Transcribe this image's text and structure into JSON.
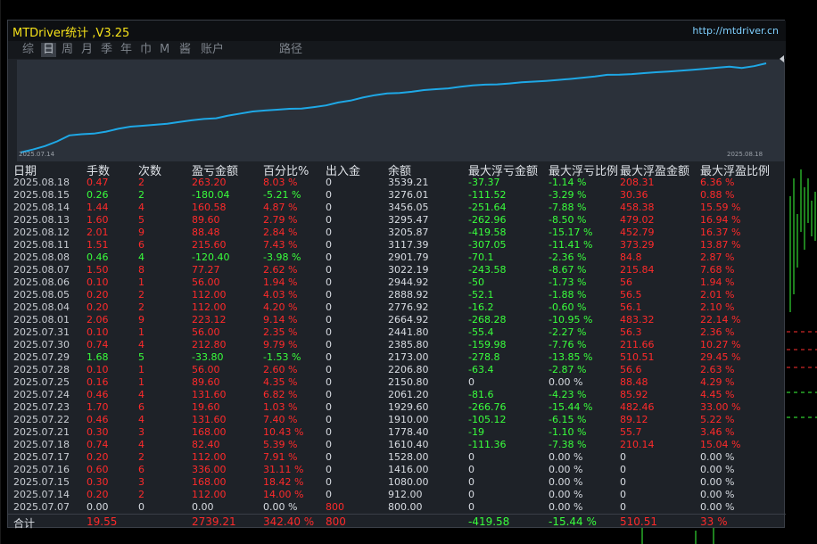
{
  "window": {
    "title": "MTDriver统计 ,V3.25",
    "url": "http://mtdriver.cn"
  },
  "tabs": [
    {
      "label": "综",
      "active": false
    },
    {
      "label": "日",
      "active": true
    },
    {
      "label": "周",
      "active": false
    },
    {
      "label": "月",
      "active": false
    },
    {
      "label": "季",
      "active": false
    },
    {
      "label": "年",
      "active": false
    },
    {
      "label": "巾",
      "active": false
    },
    {
      "label": "M",
      "active": false
    },
    {
      "label": "酱",
      "active": false
    },
    {
      "label": "账户",
      "active": false
    },
    {
      "label": "路径",
      "active": false
    }
  ],
  "equity_chart": {
    "start_date": "2025.07.14",
    "end_date": "2025.08.18",
    "line_color": "#1ea8e6",
    "values": [
      912,
      1000,
      1100,
      1240,
      1416,
      1450,
      1470,
      1528,
      1610,
      1675,
      1700,
      1730,
      1760,
      1810,
      1860,
      1900,
      1920,
      2000,
      2061,
      2120,
      2150,
      2173,
      2200,
      2206,
      2250,
      2300,
      2386,
      2441,
      2530,
      2600,
      2650,
      2665,
      2700,
      2750,
      2777,
      2800,
      2850,
      2889,
      2910,
      2920,
      2945,
      2980,
      3000,
      3022,
      3050,
      3080,
      3117,
      3150,
      3200,
      3206,
      3220,
      3250,
      3276,
      3295,
      3320,
      3350,
      3380,
      3410,
      3440,
      3400,
      3456,
      3539
    ]
  },
  "table": {
    "headers": [
      "日期",
      "手数",
      "次数",
      "盈亏金额",
      "百分比%",
      "出入金",
      "余额",
      "最大浮亏金额",
      "最大浮亏比例",
      "最大浮盈金额",
      "最大浮盈比例"
    ],
    "rows": [
      {
        "date": "2025.08.18",
        "lots": "0.47",
        "count": "2",
        "pnl": "263.20",
        "pct": "8.03 %",
        "io": "0",
        "balance": "3539.21",
        "maxdd": "-37.37",
        "maxdd_pct": "-1.14 %",
        "maxfp": "208.31",
        "maxfp_pct": "6.36 %",
        "sign": "pos"
      },
      {
        "date": "2025.08.15",
        "lots": "0.26",
        "count": "2",
        "pnl": "-180.04",
        "pct": "-5.21 %",
        "io": "0",
        "balance": "3276.01",
        "maxdd": "-111.52",
        "maxdd_pct": "-3.29 %",
        "maxfp": "30.36",
        "maxfp_pct": "0.88 %",
        "sign": "neg"
      },
      {
        "date": "2025.08.14",
        "lots": "1.44",
        "count": "4",
        "pnl": "160.58",
        "pct": "4.87 %",
        "io": "0",
        "balance": "3456.05",
        "maxdd": "-251.64",
        "maxdd_pct": "-7.88 %",
        "maxfp": "458.38",
        "maxfp_pct": "15.59 %",
        "sign": "pos"
      },
      {
        "date": "2025.08.13",
        "lots": "1.60",
        "count": "5",
        "pnl": "89.60",
        "pct": "2.79 %",
        "io": "0",
        "balance": "3295.47",
        "maxdd": "-262.96",
        "maxdd_pct": "-8.50 %",
        "maxfp": "479.02",
        "maxfp_pct": "16.94 %",
        "sign": "pos"
      },
      {
        "date": "2025.08.12",
        "lots": "2.01",
        "count": "9",
        "pnl": "88.48",
        "pct": "2.84 %",
        "io": "0",
        "balance": "3205.87",
        "maxdd": "-419.58",
        "maxdd_pct": "-15.17 %",
        "maxfp": "452.79",
        "maxfp_pct": "16.37 %",
        "sign": "pos"
      },
      {
        "date": "2025.08.11",
        "lots": "1.51",
        "count": "6",
        "pnl": "215.60",
        "pct": "7.43 %",
        "io": "0",
        "balance": "3117.39",
        "maxdd": "-307.05",
        "maxdd_pct": "-11.41 %",
        "maxfp": "373.29",
        "maxfp_pct": "13.87 %",
        "sign": "pos"
      },
      {
        "date": "2025.08.08",
        "lots": "0.46",
        "count": "4",
        "pnl": "-120.40",
        "pct": "-3.98 %",
        "io": "0",
        "balance": "2901.79",
        "maxdd": "-70.1",
        "maxdd_pct": "-2.36 %",
        "maxfp": "84.8",
        "maxfp_pct": "2.87 %",
        "sign": "neg"
      },
      {
        "date": "2025.08.07",
        "lots": "1.50",
        "count": "8",
        "pnl": "77.27",
        "pct": "2.62 %",
        "io": "0",
        "balance": "3022.19",
        "maxdd": "-243.58",
        "maxdd_pct": "-8.67 %",
        "maxfp": "215.84",
        "maxfp_pct": "7.68 %",
        "sign": "pos"
      },
      {
        "date": "2025.08.06",
        "lots": "0.10",
        "count": "1",
        "pnl": "56.00",
        "pct": "1.94 %",
        "io": "0",
        "balance": "2944.92",
        "maxdd": "-50",
        "maxdd_pct": "-1.73 %",
        "maxfp": "56",
        "maxfp_pct": "1.94 %",
        "sign": "pos"
      },
      {
        "date": "2025.08.05",
        "lots": "0.20",
        "count": "2",
        "pnl": "112.00",
        "pct": "4.03 %",
        "io": "0",
        "balance": "2888.92",
        "maxdd": "-52.1",
        "maxdd_pct": "-1.88 %",
        "maxfp": "56.5",
        "maxfp_pct": "2.01 %",
        "sign": "pos"
      },
      {
        "date": "2025.08.04",
        "lots": "0.20",
        "count": "2",
        "pnl": "112.00",
        "pct": "4.20 %",
        "io": "0",
        "balance": "2776.92",
        "maxdd": "-16.2",
        "maxdd_pct": "-0.60 %",
        "maxfp": "56.1",
        "maxfp_pct": "2.10 %",
        "sign": "pos"
      },
      {
        "date": "2025.08.01",
        "lots": "2.06",
        "count": "9",
        "pnl": "223.12",
        "pct": "9.14 %",
        "io": "0",
        "balance": "2664.92",
        "maxdd": "-268.28",
        "maxdd_pct": "-10.95 %",
        "maxfp": "483.32",
        "maxfp_pct": "22.14 %",
        "sign": "pos"
      },
      {
        "date": "2025.07.31",
        "lots": "0.10",
        "count": "1",
        "pnl": "56.00",
        "pct": "2.35 %",
        "io": "0",
        "balance": "2441.80",
        "maxdd": "-55.4",
        "maxdd_pct": "-2.27 %",
        "maxfp": "56.3",
        "maxfp_pct": "2.36 %",
        "sign": "pos"
      },
      {
        "date": "2025.07.30",
        "lots": "0.74",
        "count": "4",
        "pnl": "212.80",
        "pct": "9.79 %",
        "io": "0",
        "balance": "2385.80",
        "maxdd": "-159.98",
        "maxdd_pct": "-7.76 %",
        "maxfp": "211.66",
        "maxfp_pct": "10.27 %",
        "sign": "pos"
      },
      {
        "date": "2025.07.29",
        "lots": "1.68",
        "count": "5",
        "pnl": "-33.80",
        "pct": "-1.53 %",
        "io": "0",
        "balance": "2173.00",
        "maxdd": "-278.8",
        "maxdd_pct": "-13.85 %",
        "maxfp": "510.51",
        "maxfp_pct": "29.45 %",
        "sign": "neg"
      },
      {
        "date": "2025.07.28",
        "lots": "0.10",
        "count": "1",
        "pnl": "56.00",
        "pct": "2.60 %",
        "io": "0",
        "balance": "2206.80",
        "maxdd": "-63.4",
        "maxdd_pct": "-2.87 %",
        "maxfp": "56.6",
        "maxfp_pct": "2.63 %",
        "sign": "pos"
      },
      {
        "date": "2025.07.25",
        "lots": "0.16",
        "count": "1",
        "pnl": "89.60",
        "pct": "4.35 %",
        "io": "0",
        "balance": "2150.80",
        "maxdd": "0",
        "maxdd_pct": "0.00 %",
        "maxfp": "88.48",
        "maxfp_pct": "4.29 %",
        "sign": "pos"
      },
      {
        "date": "2025.07.24",
        "lots": "0.46",
        "count": "4",
        "pnl": "131.60",
        "pct": "6.82 %",
        "io": "0",
        "balance": "2061.20",
        "maxdd": "-81.6",
        "maxdd_pct": "-4.23 %",
        "maxfp": "85.92",
        "maxfp_pct": "4.45 %",
        "sign": "pos"
      },
      {
        "date": "2025.07.23",
        "lots": "1.70",
        "count": "6",
        "pnl": "19.60",
        "pct": "1.03 %",
        "io": "0",
        "balance": "1929.60",
        "maxdd": "-266.76",
        "maxdd_pct": "-15.44 %",
        "maxfp": "482.46",
        "maxfp_pct": "33.00 %",
        "sign": "pos"
      },
      {
        "date": "2025.07.22",
        "lots": "0.46",
        "count": "4",
        "pnl": "131.60",
        "pct": "7.40 %",
        "io": "0",
        "balance": "1910.00",
        "maxdd": "-105.12",
        "maxdd_pct": "-6.15 %",
        "maxfp": "89.12",
        "maxfp_pct": "5.22 %",
        "sign": "pos"
      },
      {
        "date": "2025.07.21",
        "lots": "0.30",
        "count": "3",
        "pnl": "168.00",
        "pct": "10.43 %",
        "io": "0",
        "balance": "1778.40",
        "maxdd": "-19",
        "maxdd_pct": "-1.10 %",
        "maxfp": "55.7",
        "maxfp_pct": "3.46 %",
        "sign": "pos"
      },
      {
        "date": "2025.07.18",
        "lots": "0.74",
        "count": "4",
        "pnl": "82.40",
        "pct": "5.39 %",
        "io": "0",
        "balance": "1610.40",
        "maxdd": "-111.36",
        "maxdd_pct": "-7.38 %",
        "maxfp": "210.14",
        "maxfp_pct": "15.04 %",
        "sign": "pos"
      },
      {
        "date": "2025.07.17",
        "lots": "0.20",
        "count": "2",
        "pnl": "112.00",
        "pct": "7.91 %",
        "io": "0",
        "balance": "1528.00",
        "maxdd": "0",
        "maxdd_pct": "0.00 %",
        "maxfp": "0",
        "maxfp_pct": "0.00 %",
        "sign": "pos"
      },
      {
        "date": "2025.07.16",
        "lots": "0.60",
        "count": "6",
        "pnl": "336.00",
        "pct": "31.11 %",
        "io": "0",
        "balance": "1416.00",
        "maxdd": "0",
        "maxdd_pct": "0.00 %",
        "maxfp": "0",
        "maxfp_pct": "0.00 %",
        "sign": "pos"
      },
      {
        "date": "2025.07.15",
        "lots": "0.30",
        "count": "3",
        "pnl": "168.00",
        "pct": "18.42 %",
        "io": "0",
        "balance": "1080.00",
        "maxdd": "0",
        "maxdd_pct": "0.00 %",
        "maxfp": "0",
        "maxfp_pct": "0.00 %",
        "sign": "pos"
      },
      {
        "date": "2025.07.14",
        "lots": "0.20",
        "count": "2",
        "pnl": "112.00",
        "pct": "14.00 %",
        "io": "0",
        "balance": "912.00",
        "maxdd": "0",
        "maxdd_pct": "0.00 %",
        "maxfp": "0",
        "maxfp_pct": "0.00 %",
        "sign": "pos"
      },
      {
        "date": "2025.07.07",
        "lots": "0.00",
        "count": "0",
        "pnl": "0.00",
        "pct": "0.00 %",
        "io": "800",
        "balance": "800.00",
        "maxdd": "0",
        "maxdd_pct": "0.00 %",
        "maxfp": "0",
        "maxfp_pct": "0.00 %",
        "sign": "zero"
      }
    ],
    "total": {
      "label": "合计",
      "lots": "19.55",
      "pnl": "2739.21",
      "pct": "342.40 %",
      "io": "800",
      "maxdd": "-419.58",
      "maxdd_pct": "-15.44 %",
      "maxfp": "510.51",
      "maxfp_pct": "33 %"
    }
  },
  "colors": {
    "positive": "#ff2a2a",
    "negative": "#39ff3c",
    "neutral": "#d8dce2",
    "title": "#f5e11a",
    "url": "#7fd0ff"
  }
}
